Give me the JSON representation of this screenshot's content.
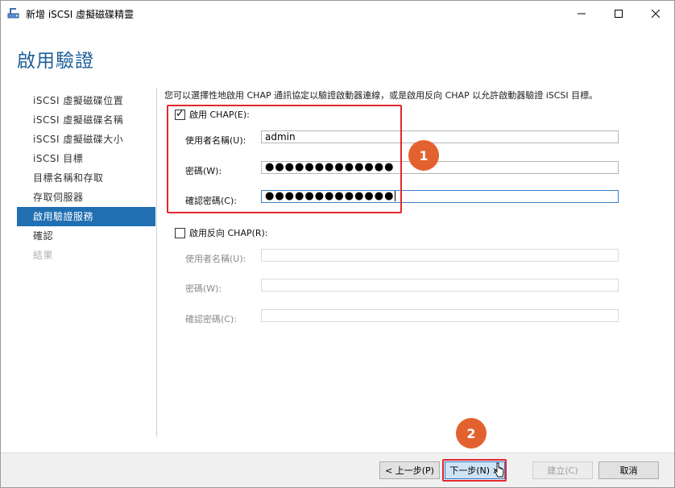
{
  "window": {
    "title": "新增 iSCSI 虛擬磁碟精靈",
    "icon": "wizard-disk-icon",
    "controls": {
      "minimize": "minimize-icon",
      "maximize": "maximize-icon",
      "close": "close-icon"
    }
  },
  "page_title": "啟用驗證",
  "nav": [
    {
      "label": "iSCSI 虛擬磁碟位置",
      "state": "normal"
    },
    {
      "label": "iSCSI 虛擬磁碟名稱",
      "state": "normal"
    },
    {
      "label": "iSCSI 虛擬磁碟大小",
      "state": "normal"
    },
    {
      "label": "iSCSI 目標",
      "state": "normal"
    },
    {
      "label": "目標名稱和存取",
      "state": "normal"
    },
    {
      "label": "存取伺服器",
      "state": "normal"
    },
    {
      "label": "啟用驗證服務",
      "state": "active"
    },
    {
      "label": "確認",
      "state": "normal"
    },
    {
      "label": "結果",
      "state": "disabled"
    }
  ],
  "description": "您可以選擇性地啟用 CHAP 通訊協定以驗證啟動器連線，或是啟用反向 CHAP 以允許啟動器驗證 iSCSI 目標。",
  "chap": {
    "enable_label": "啟用 CHAP(E):",
    "checked": true,
    "username_label": "使用者名稱(U):",
    "username_value": "admin",
    "password_label": "密碼(W):",
    "password_value": "●●●●●●●●●●●●●",
    "confirm_label": "確認密碼(C):",
    "confirm_value": "●●●●●●●●●●●●●"
  },
  "reverse_chap": {
    "enable_label": "啟用反向 CHAP(R):",
    "checked": false,
    "username_label": "使用者名稱(U):",
    "password_label": "密碼(W):",
    "confirm_label": "確認密碼(C):"
  },
  "annotations": {
    "badge1": "1",
    "badge2": "2"
  },
  "buttons": {
    "prev": "< 上一步(P)",
    "next": "下一步(N) >",
    "create": "建立(C)",
    "cancel": "取消"
  },
  "colors": {
    "accent": "#1f6fb2",
    "title": "#1c5f9a",
    "highlight_box": "#e0282d",
    "badge": "#e2622f"
  }
}
